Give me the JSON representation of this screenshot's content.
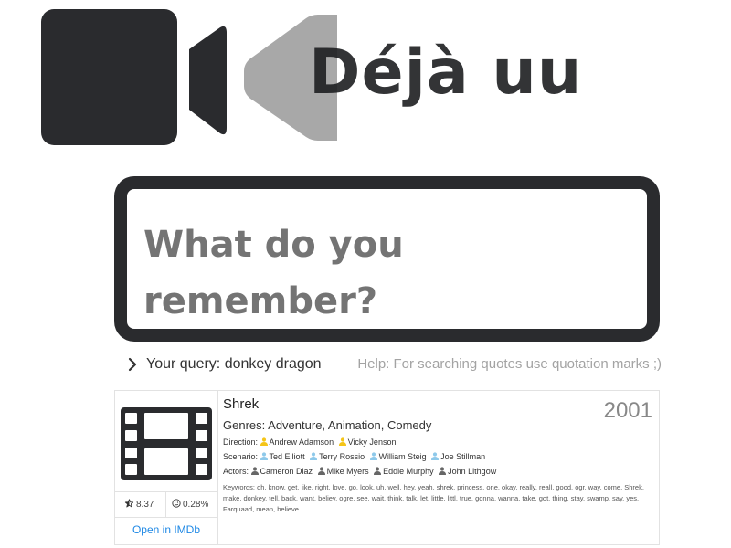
{
  "brand": {
    "name": "Déjà uu",
    "colors": {
      "dark": "#2a2b2e",
      "grey": "#a8a8a8",
      "link": "#1e88e5"
    }
  },
  "search": {
    "placeholder": "What do you remember?"
  },
  "query": {
    "prefix": "Your query:",
    "value": "donkey dragon",
    "help": "Help: For searching quotes use quotation marks ;)"
  },
  "result": {
    "title": "Shrek",
    "year": "2001",
    "genres": {
      "label": "Genres:",
      "value": "Adventure, Animation, Comedy"
    },
    "direction": {
      "label": "Direction:",
      "people": [
        {
          "name": "Andrew Adamson",
          "icon": "person-icon",
          "color": "#f5c518"
        },
        {
          "name": "Vicky Jenson",
          "icon": "person-icon",
          "color": "#f5c518"
        }
      ]
    },
    "scenario": {
      "label": "Scenario:",
      "people": [
        {
          "name": "Ted Elliott",
          "icon": "person-icon",
          "color": "#8ec9ea"
        },
        {
          "name": "Terry Rossio",
          "icon": "person-icon",
          "color": "#8ec9ea"
        },
        {
          "name": "William Steig",
          "icon": "person-icon",
          "color": "#8ec9ea"
        },
        {
          "name": "Joe Stillman",
          "icon": "person-icon",
          "color": "#8ec9ea"
        }
      ]
    },
    "actors": {
      "label": "Actors:",
      "people": [
        {
          "name": "Cameron Diaz",
          "icon": "person-icon",
          "color": "#666666"
        },
        {
          "name": "Mike Myers",
          "icon": "person-icon",
          "color": "#666666"
        },
        {
          "name": "Eddie Murphy",
          "icon": "person-icon",
          "color": "#666666"
        },
        {
          "name": "John Lithgow",
          "icon": "person-icon",
          "color": "#666666"
        }
      ]
    },
    "keywords": {
      "label": "Keywords:",
      "value": "oh, know, get, like, right, love, go, look, uh, well, hey, yeah, shrek, princess, one, okay, really, reall, good, ogr, way, come, Shrek, make, donkey, tell, back, want, believ, ogre, see, wait, think, talk, let, little, littl, true, gonna, wanna, take, got, thing, stay, swamp, say, yes, Farquaad, mean, believe"
    },
    "rating": "8.37",
    "match": "0.28%",
    "imdb_link": "Open in IMDb"
  }
}
